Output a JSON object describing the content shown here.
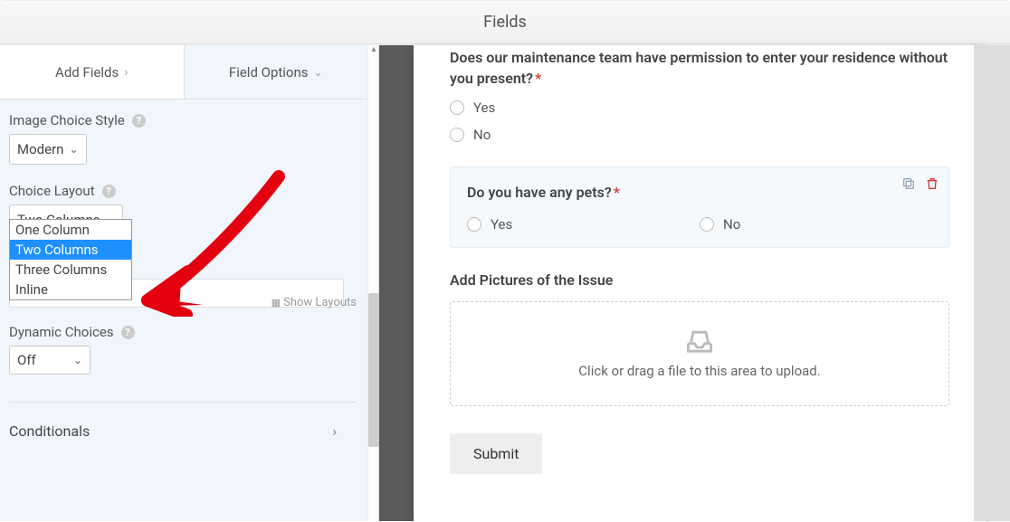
{
  "header": {
    "title": "Fields"
  },
  "tabs": {
    "add": "Add Fields",
    "options": "Field Options"
  },
  "sidebar": {
    "image_choice_style": {
      "label": "Image Choice Style",
      "value": "Modern"
    },
    "choice_layout": {
      "label": "Choice Layout",
      "value": "Two Columns",
      "options": [
        "One Column",
        "Two Columns",
        "Three Columns",
        "Inline"
      ],
      "show_layouts": "Show Layouts"
    },
    "dynamic_choices": {
      "label": "Dynamic Choices",
      "value": "Off"
    },
    "conditionals": "Conditionals"
  },
  "form": {
    "q1": {
      "title": "Does our maintenance team have permission to enter your residence without you present?",
      "options": [
        "Yes",
        "No"
      ]
    },
    "q2": {
      "title": "Do you have any pets?",
      "options": [
        "Yes",
        "No"
      ]
    },
    "upload": {
      "label": "Add Pictures of the Issue",
      "hint": "Click or drag a file to this area to upload."
    },
    "submit": "Submit"
  }
}
